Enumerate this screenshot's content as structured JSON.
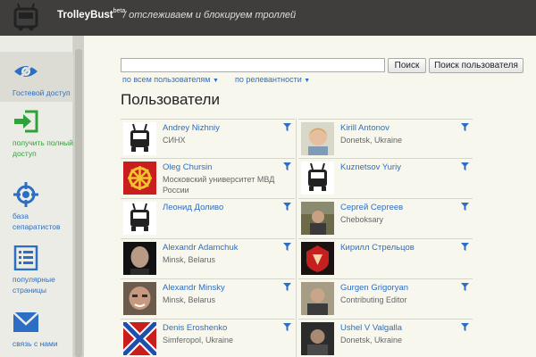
{
  "header": {
    "brand": "TrolleyBust",
    "beta": "beta",
    "tagline": "/ отслеживаем и блокируем троллей"
  },
  "sidebar": {
    "items": [
      {
        "label": "Гостевой доступ",
        "icon": "eye-icon",
        "color": "#2c6ec4"
      },
      {
        "label": "получить полный доступ",
        "icon": "login-arrow-icon",
        "color": "#2fa33a"
      },
      {
        "label": "база сепаратистов",
        "icon": "crosshair-icon",
        "color": "#2c6ec4"
      },
      {
        "label": "популярные страницы",
        "icon": "list-icon",
        "color": "#2c6ec4"
      },
      {
        "label": "связь с нами",
        "icon": "envelope-icon",
        "color": "#2c6ec4"
      }
    ]
  },
  "search": {
    "value": "",
    "placeholder": "",
    "search_button": "Поиск",
    "user_search_button": "Поиск пользователя",
    "filter_scope": "по всем пользователям",
    "filter_sort": "по релевантности"
  },
  "page": {
    "title": "Пользователи"
  },
  "users": [
    {
      "name": "Andrey Nizhniy",
      "sub": "СИНХ",
      "avatar": "trolley-avatar"
    },
    {
      "name": "Kirill Antonov",
      "sub": "Donetsk, Ukraine",
      "avatar": "child-photo"
    },
    {
      "name": "Oleg Chursin",
      "sub": "Московский университет МВД России",
      "avatar": "kolovrat-symbol"
    },
    {
      "name": "Kuznetsov Yuriy",
      "sub": "",
      "avatar": "trolley-avatar"
    },
    {
      "name": "Леонид Доливо",
      "sub": "",
      "avatar": "trolley-avatar"
    },
    {
      "name": "Сергей Сергеев",
      "sub": "Cheboksary",
      "avatar": "photo"
    },
    {
      "name": "Alexandr Adamchuk",
      "sub": "Minsk, Belarus",
      "avatar": "face-photo"
    },
    {
      "name": "Кирилл Стрельцов",
      "sub": "",
      "avatar": "red-emblem"
    },
    {
      "name": "Alexandr Minsky",
      "sub": "Minsk, Belarus",
      "avatar": "face-photo"
    },
    {
      "name": "Gurgen Grigoryan",
      "sub": "Contributing Editor",
      "avatar": "portrait-photo"
    },
    {
      "name": "Denis Eroshenko",
      "sub": "Simferopol, Ukraine",
      "avatar": "novorossiya-flag"
    },
    {
      "name": "Ushel V Valgalla",
      "sub": "Donetsk, Ukraine",
      "avatar": "photo"
    }
  ]
}
